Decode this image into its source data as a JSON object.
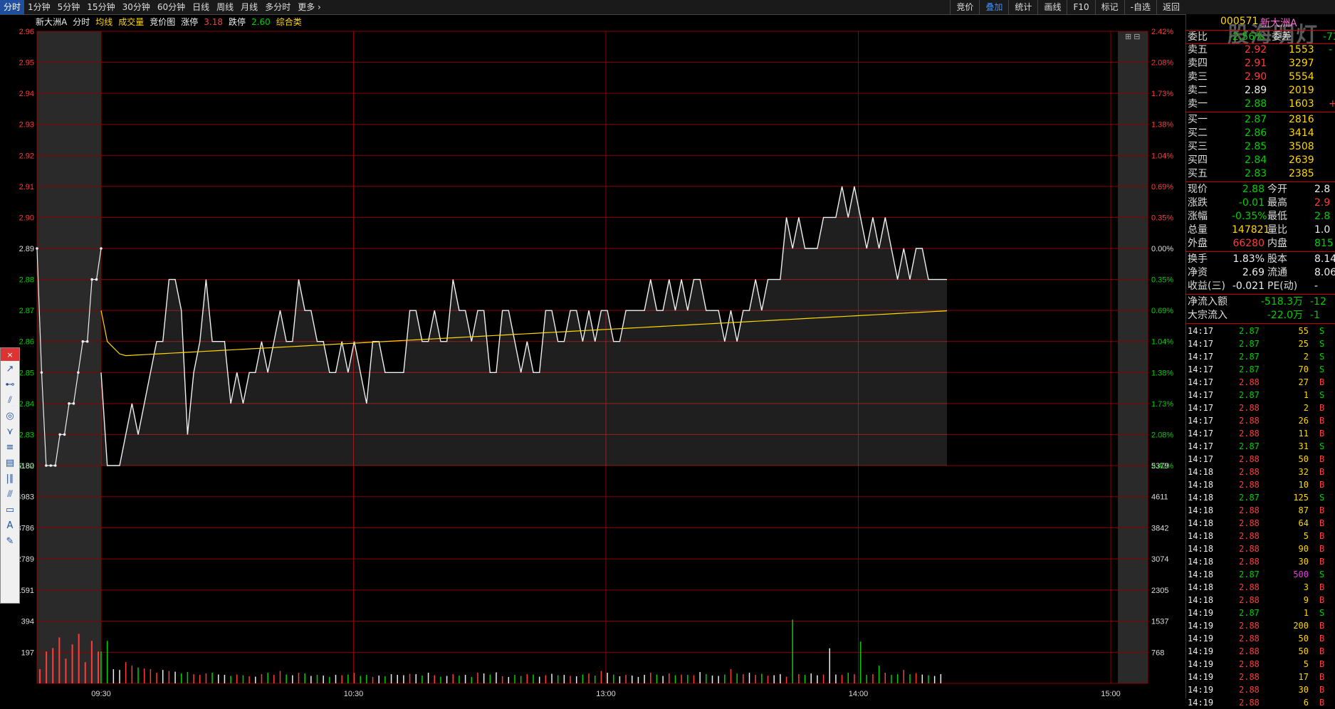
{
  "toolbar": {
    "periods": [
      {
        "label": "分时",
        "active": true
      },
      {
        "label": "1分钟"
      },
      {
        "label": "5分钟"
      },
      {
        "label": "15分钟"
      },
      {
        "label": "30分钟"
      },
      {
        "label": "60分钟"
      },
      {
        "label": "日线"
      },
      {
        "label": "周线"
      },
      {
        "label": "月线"
      },
      {
        "label": "多分时"
      },
      {
        "label": "更多"
      }
    ],
    "tools": [
      {
        "label": "竞价"
      },
      {
        "label": "叠加",
        "active": true
      },
      {
        "label": "统计"
      },
      {
        "label": "画线"
      },
      {
        "label": "F10"
      },
      {
        "label": "标记"
      },
      {
        "label": "-自选"
      },
      {
        "label": "返回"
      }
    ]
  },
  "infobar": {
    "stock_name": "新大洲A",
    "mode": "分时",
    "avg_label": "均线",
    "vol_label": "成交量",
    "auction_label": "竞价图",
    "limit_up_label": "涨停",
    "limit_up": "3.18",
    "limit_down_label": "跌停",
    "limit_down": "2.60",
    "sector": "综合类"
  },
  "header": {
    "code": "000571",
    "name": "新大洲A",
    "watermark": "股海明灯"
  },
  "colors": {
    "up": "#ff3b3b",
    "down": "#00d000",
    "flat": "#eeeeee",
    "avg": "#ffd700",
    "grid": "#8b0000",
    "accent": "#1f4f9e"
  },
  "chart_data": {
    "type": "line",
    "price_axis_left": [
      "2.96",
      "2.95",
      "2.94",
      "2.93",
      "2.92",
      "2.91",
      "2.90",
      "2.89",
      "2.88",
      "2.87",
      "2.86",
      "2.85",
      "2.84",
      "2.83",
      "2.82"
    ],
    "pct_axis_right": [
      "2.42%",
      "2.08%",
      "1.73%",
      "1.38%",
      "1.04%",
      "0.69%",
      "0.35%",
      "0.00%",
      "0.35%",
      "0.69%",
      "1.04%",
      "1.38%",
      "1.73%",
      "2.08%",
      "2.42%"
    ],
    "prev_close": 2.89,
    "price_range": [
      2.82,
      2.96
    ],
    "vol_axis_left": [
      "6180",
      "4983",
      "3786",
      "2789",
      "1591",
      "394",
      "197"
    ],
    "vol_axis_right": [
      "5379",
      "4611",
      "3842",
      "3074",
      "2305",
      "1537",
      "768"
    ],
    "vol_max": 6150,
    "time_labels": [
      "09:30",
      "10:30",
      "13:00",
      "14:00",
      "15:00"
    ],
    "total_minutes": 240,
    "auction_minutes": 10,
    "price": [
      2.85,
      2.82,
      2.82,
      2.82,
      2.83,
      2.84,
      2.83,
      2.84,
      2.85,
      2.86,
      2.86,
      2.88,
      2.88,
      2.87,
      2.83,
      2.85,
      2.86,
      2.88,
      2.86,
      2.86,
      2.86,
      2.84,
      2.85,
      2.84,
      2.85,
      2.85,
      2.86,
      2.85,
      2.86,
      2.87,
      2.86,
      2.86,
      2.88,
      2.87,
      2.87,
      2.86,
      2.86,
      2.85,
      2.85,
      2.86,
      2.85,
      2.86,
      2.85,
      2.84,
      2.86,
      2.86,
      2.85,
      2.85,
      2.85,
      2.85,
      2.87,
      2.87,
      2.86,
      2.86,
      2.87,
      2.86,
      2.86,
      2.88,
      2.87,
      2.87,
      2.86,
      2.87,
      2.87,
      2.85,
      2.85,
      2.87,
      2.87,
      2.86,
      2.85,
      2.86,
      2.85,
      2.85,
      2.87,
      2.87,
      2.86,
      2.86,
      2.87,
      2.87,
      2.86,
      2.87,
      2.86,
      2.87,
      2.87,
      2.86,
      2.86,
      2.87,
      2.87,
      2.87,
      2.87,
      2.88,
      2.87,
      2.87,
      2.88,
      2.87,
      2.88,
      2.87,
      2.88,
      2.88,
      2.87,
      2.87,
      2.87,
      2.86,
      2.87,
      2.86,
      2.87,
      2.87,
      2.88,
      2.87,
      2.88,
      2.88,
      2.88,
      2.9,
      2.89,
      2.9,
      2.89,
      2.89,
      2.89,
      2.9,
      2.9,
      2.9,
      2.91,
      2.9,
      2.91,
      2.9,
      2.89,
      2.9,
      2.89,
      2.9,
      2.89,
      2.88,
      2.89,
      2.88,
      2.89,
      2.89,
      2.88,
      2.88,
      2.88,
      2.88
    ],
    "vwap_start": 2.87,
    "vwap_end": 2.87,
    "volume": [
      900,
      1200,
      400,
      380,
      600,
      500,
      450,
      420,
      400,
      300,
      380,
      350,
      330,
      280,
      320,
      260,
      240,
      280,
      300,
      250,
      240,
      210,
      250,
      230,
      200,
      190,
      260,
      300,
      240,
      350,
      250,
      230,
      300,
      280,
      210,
      240,
      220,
      180,
      240,
      230,
      250,
      300,
      210,
      240,
      180,
      220,
      200,
      260,
      240,
      230,
      270,
      260,
      220,
      300,
      230,
      190,
      210,
      260,
      220,
      240,
      180,
      300,
      280,
      250,
      310,
      200,
      180,
      240,
      210,
      260,
      250,
      190,
      230,
      270,
      230,
      240,
      210,
      200,
      250,
      280,
      220,
      350,
      300,
      250,
      200,
      240,
      220,
      180,
      240,
      300,
      250,
      210,
      280,
      230,
      250,
      240,
      230,
      320,
      260,
      220,
      210,
      250,
      400,
      280,
      260,
      300,
      240,
      270,
      220,
      230,
      260,
      190,
      1800,
      260,
      240,
      280,
      230,
      250,
      990,
      250,
      240,
      300,
      260,
      1180,
      240,
      260,
      500,
      300,
      240,
      260,
      380,
      260,
      290,
      250,
      230,
      210,
      260
    ],
    "auction_volume": [
      400,
      900,
      1000,
      1300,
      700,
      1100,
      1400,
      600,
      1200,
      900
    ]
  },
  "orderbook": {
    "weibi_label": "委比",
    "weibi_value": "-2.56%",
    "weicha_label": "委差",
    "weicha_value": "-73",
    "asks": [
      {
        "label": "卖五",
        "price": "2.92",
        "vol": "1553",
        "chg": "-"
      },
      {
        "label": "卖四",
        "price": "2.91",
        "vol": "3297",
        "chg": ""
      },
      {
        "label": "卖三",
        "price": "2.90",
        "vol": "5554",
        "chg": ""
      },
      {
        "label": "卖二",
        "price": "2.89",
        "vol": "2019",
        "chg": ""
      },
      {
        "label": "卖一",
        "price": "2.88",
        "vol": "1603",
        "chg": "+"
      }
    ],
    "bids": [
      {
        "label": "买一",
        "price": "2.87",
        "vol": "2816"
      },
      {
        "label": "买二",
        "price": "2.86",
        "vol": "3414"
      },
      {
        "label": "买三",
        "price": "2.85",
        "vol": "3508"
      },
      {
        "label": "买四",
        "price": "2.84",
        "vol": "2639"
      },
      {
        "label": "买五",
        "price": "2.83",
        "vol": "2385"
      }
    ]
  },
  "quote": {
    "rows": [
      {
        "l1": "现价",
        "v1": "2.88",
        "c1": "green",
        "l2": "今开",
        "v2": "2.8",
        "c2": "white"
      },
      {
        "l1": "涨跌",
        "v1": "-0.01",
        "c1": "green",
        "l2": "最高",
        "v2": "2.9",
        "c2": "red"
      },
      {
        "l1": "涨幅",
        "v1": "-0.35%",
        "c1": "green",
        "l2": "最低",
        "v2": "2.8",
        "c2": "green"
      },
      {
        "l1": "总量",
        "v1": "147821",
        "c1": "yellow",
        "l2": "量比",
        "v2": "1.0",
        "c2": "white"
      },
      {
        "l1": "外盘",
        "v1": "66280",
        "c1": "red",
        "l2": "内盘",
        "v2": "815",
        "c2": "green"
      }
    ],
    "rows2": [
      {
        "l1": "换手",
        "v1": "1.83%",
        "c1": "white",
        "l2": "股本",
        "v2": "8.14",
        "c2": "white"
      },
      {
        "l1": "净资",
        "v1": "2.69",
        "c1": "white",
        "l2": "流通",
        "v2": "8.06",
        "c2": "white"
      },
      {
        "l1": "收益(三)",
        "v1": "-0.021",
        "c1": "white",
        "l2": "PE(动)",
        "v2": "-",
        "c2": "white"
      }
    ],
    "flow": [
      {
        "label": "净流入额",
        "v1": "-518.3万",
        "v2": "-12"
      },
      {
        "label": "大宗流入",
        "v1": "-22.0万",
        "v2": "-1"
      }
    ]
  },
  "ticks": [
    {
      "time": "14:17",
      "price": "2.87",
      "vol": "55",
      "bs": "S"
    },
    {
      "time": "14:17",
      "price": "2.87",
      "vol": "25",
      "bs": "S"
    },
    {
      "time": "14:17",
      "price": "2.87",
      "vol": "2",
      "bs": "S"
    },
    {
      "time": "14:17",
      "price": "2.87",
      "vol": "70",
      "bs": "S"
    },
    {
      "time": "14:17",
      "price": "2.88",
      "vol": "27",
      "bs": "B"
    },
    {
      "time": "14:17",
      "price": "2.87",
      "vol": "1",
      "bs": "S"
    },
    {
      "time": "14:17",
      "price": "2.88",
      "vol": "2",
      "bs": "B"
    },
    {
      "time": "14:17",
      "price": "2.88",
      "vol": "26",
      "bs": "B"
    },
    {
      "time": "14:17",
      "price": "2.88",
      "vol": "11",
      "bs": "B"
    },
    {
      "time": "14:17",
      "price": "2.87",
      "vol": "31",
      "bs": "S"
    },
    {
      "time": "14:17",
      "price": "2.88",
      "vol": "50",
      "bs": "B"
    },
    {
      "time": "14:18",
      "price": "2.88",
      "vol": "32",
      "bs": "B"
    },
    {
      "time": "14:18",
      "price": "2.88",
      "vol": "10",
      "bs": "B"
    },
    {
      "time": "14:18",
      "price": "2.87",
      "vol": "125",
      "bs": "S"
    },
    {
      "time": "14:18",
      "price": "2.88",
      "vol": "87",
      "bs": "B"
    },
    {
      "time": "14:18",
      "price": "2.88",
      "vol": "64",
      "bs": "B"
    },
    {
      "time": "14:18",
      "price": "2.88",
      "vol": "5",
      "bs": "B"
    },
    {
      "time": "14:18",
      "price": "2.88",
      "vol": "90",
      "bs": "B"
    },
    {
      "time": "14:18",
      "price": "2.88",
      "vol": "30",
      "bs": "B"
    },
    {
      "time": "14:18",
      "price": "2.87",
      "vol": "500",
      "bs": "S"
    },
    {
      "time": "14:18",
      "price": "2.88",
      "vol": "3",
      "bs": "B"
    },
    {
      "time": "14:18",
      "price": "2.88",
      "vol": "9",
      "bs": "B"
    },
    {
      "time": "14:19",
      "price": "2.87",
      "vol": "1",
      "bs": "S"
    },
    {
      "time": "14:19",
      "price": "2.88",
      "vol": "200",
      "bs": "B"
    },
    {
      "time": "14:19",
      "price": "2.88",
      "vol": "50",
      "bs": "B"
    },
    {
      "time": "14:19",
      "price": "2.88",
      "vol": "50",
      "bs": "B"
    },
    {
      "time": "14:19",
      "price": "2.88",
      "vol": "5",
      "bs": "B"
    },
    {
      "time": "14:19",
      "price": "2.88",
      "vol": "17",
      "bs": "B"
    },
    {
      "time": "14:19",
      "price": "2.88",
      "vol": "30",
      "bs": "B"
    },
    {
      "time": "14:19",
      "price": "2.88",
      "vol": "6",
      "bs": "B"
    }
  ],
  "drawtools": [
    "line-tool-icon",
    "segment-tool-icon",
    "ray-tool-icon",
    "circle-tool-icon",
    "zigzag-tool-icon",
    "parallel-tool-icon",
    "channel-tool-icon",
    "fib-tool-icon",
    "gann-tool-icon",
    "rect-tool-icon",
    "text-tool-icon",
    "brush-tool-icon"
  ],
  "drawtools_text_glyph": "A"
}
